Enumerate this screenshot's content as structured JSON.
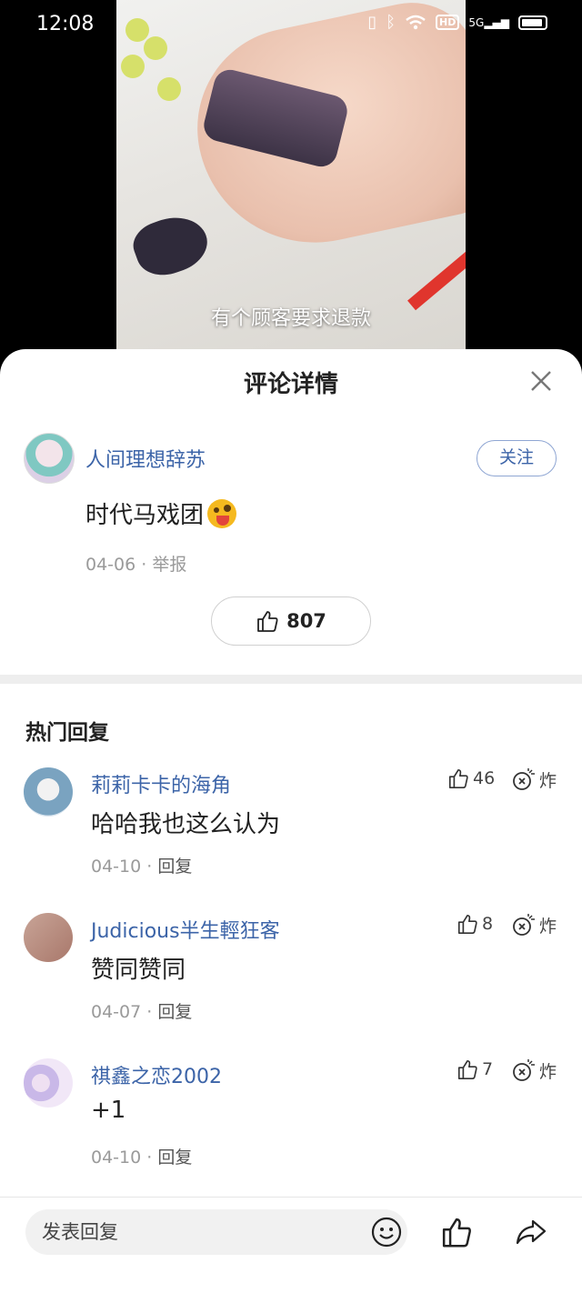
{
  "status_bar": {
    "time": "12:08",
    "hd": "HD",
    "network": "5G"
  },
  "video": {
    "subtitle": "有个顾客要求退款"
  },
  "sheet": {
    "title": "评论详情"
  },
  "main_comment": {
    "user": "人间理想辞苏",
    "follow_label": "关注",
    "text": "时代马戏团",
    "meta": "04-06 · 举报",
    "likes": "807"
  },
  "section_title": "热门回复",
  "replies": [
    {
      "user": "莉莉卡卡的海角",
      "text": "哈哈我也这么认为",
      "date": "04-10 · ",
      "reply_label": "回复",
      "likes": "46",
      "bomb_label": "炸"
    },
    {
      "user": "Judicious半生輕狂客",
      "text": "赞同赞同",
      "date": "04-07 · ",
      "reply_label": "回复",
      "likes": "8",
      "bomb_label": "炸"
    },
    {
      "user": "祺鑫之恋2002",
      "text": "+1",
      "date": "04-10 · ",
      "reply_label": "回复",
      "likes": "7",
      "bomb_label": "炸"
    }
  ],
  "bottom_bar": {
    "input_placeholder": "发表回复"
  },
  "colors": {
    "link_blue": "#3c64a8",
    "meta_gray": "#9a9a9a"
  }
}
